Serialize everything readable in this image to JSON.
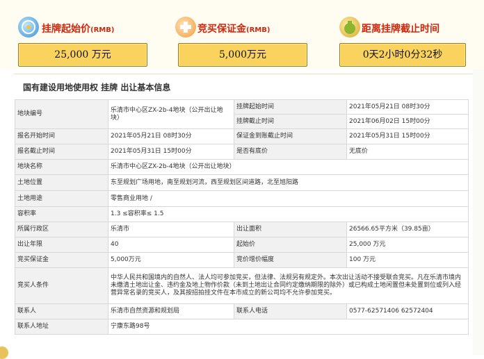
{
  "stats": [
    {
      "title": "挂牌起始价",
      "unit": "(RMB)",
      "value": "25,000 万元",
      "icon": "gear-coin-icon"
    },
    {
      "title": "竞买保证金",
      "unit": "(RMB)",
      "value": "5,000万元",
      "icon": "medical-kit-icon"
    },
    {
      "title": "距离挂牌截止时间",
      "unit": "",
      "value": "0天2小时0分32秒",
      "icon": "money-bag-icon"
    }
  ],
  "section_title": "国有建设用地使用权 挂牌 出让基本信息",
  "table": {
    "parcel_no_label": "地块编号",
    "parcel_no_value": "乐清市中心区ZX-2b-4地块（公开出让地块）",
    "start_label": "挂牌起始时间",
    "start_value": "2021年05月21日 08时30分",
    "end_label": "挂牌截止时间",
    "end_value": "2021年06月02日 15时00分",
    "reg_start_label": "报名开始时间",
    "reg_start_value": "2021年05月21日 08时30分",
    "deposit_deadline_label": "保证金到账截止时间",
    "deposit_deadline_value": "2021年05月31日 15时00分",
    "reg_end_label": "报名截止时间",
    "reg_end_value": "2021年05月31日 15时00分",
    "reserve_label": "是否有底价",
    "reserve_value": "无底价",
    "name_label": "地块名称",
    "name_value": "乐清市中心区ZX-2b-4地块（公开出让地块）",
    "location_label": "土地位置",
    "location_value": "东至规划广场用地，南至规划河流，西至规划区间道路，北至旭阳路",
    "use_label": "土地用途",
    "use_value": "零售商业用地 /",
    "far_label": "容积率",
    "far_value": "1.3 ≤容积率≤ 1.5",
    "district_label": "所属行政区",
    "district_value": "乐清市",
    "area_label": "出让面积",
    "area_value": "26566.65平方米（39.85亩）",
    "years_label": "出让年限",
    "years_value": "40",
    "start_price_label": "起始价",
    "start_price_value": "25,000 万元",
    "bid_deposit_label": "竞买保证金",
    "bid_deposit_value": "5,000万元",
    "increment_label": "竞价增价幅度",
    "increment_value": "100 万元",
    "conditions_label": "竞买人条件",
    "conditions_value": "中华人民共和国境内的自然人、法人均可参加竞买，但法律、法规另有规定外。本次出让活动不接受联合竞买。凡在乐清市境内未缴清土地出让金、违约金及地上物作价款（未到土地出让合同约定缴纳期限的除外）或已构成土地闲置但未处置到位或列入经营异常名录的竞买人，及其按招拍挂文件在本市成立的新公司均不允许参加竞买。",
    "contact_label": "联系人",
    "contact_value": "乐清市自然资源和规划局",
    "phone_label": "联系人电话",
    "phone_value": "0577-62571406 62572404",
    "address_label": "联系人地址",
    "address_value": "宁康东路98号"
  }
}
